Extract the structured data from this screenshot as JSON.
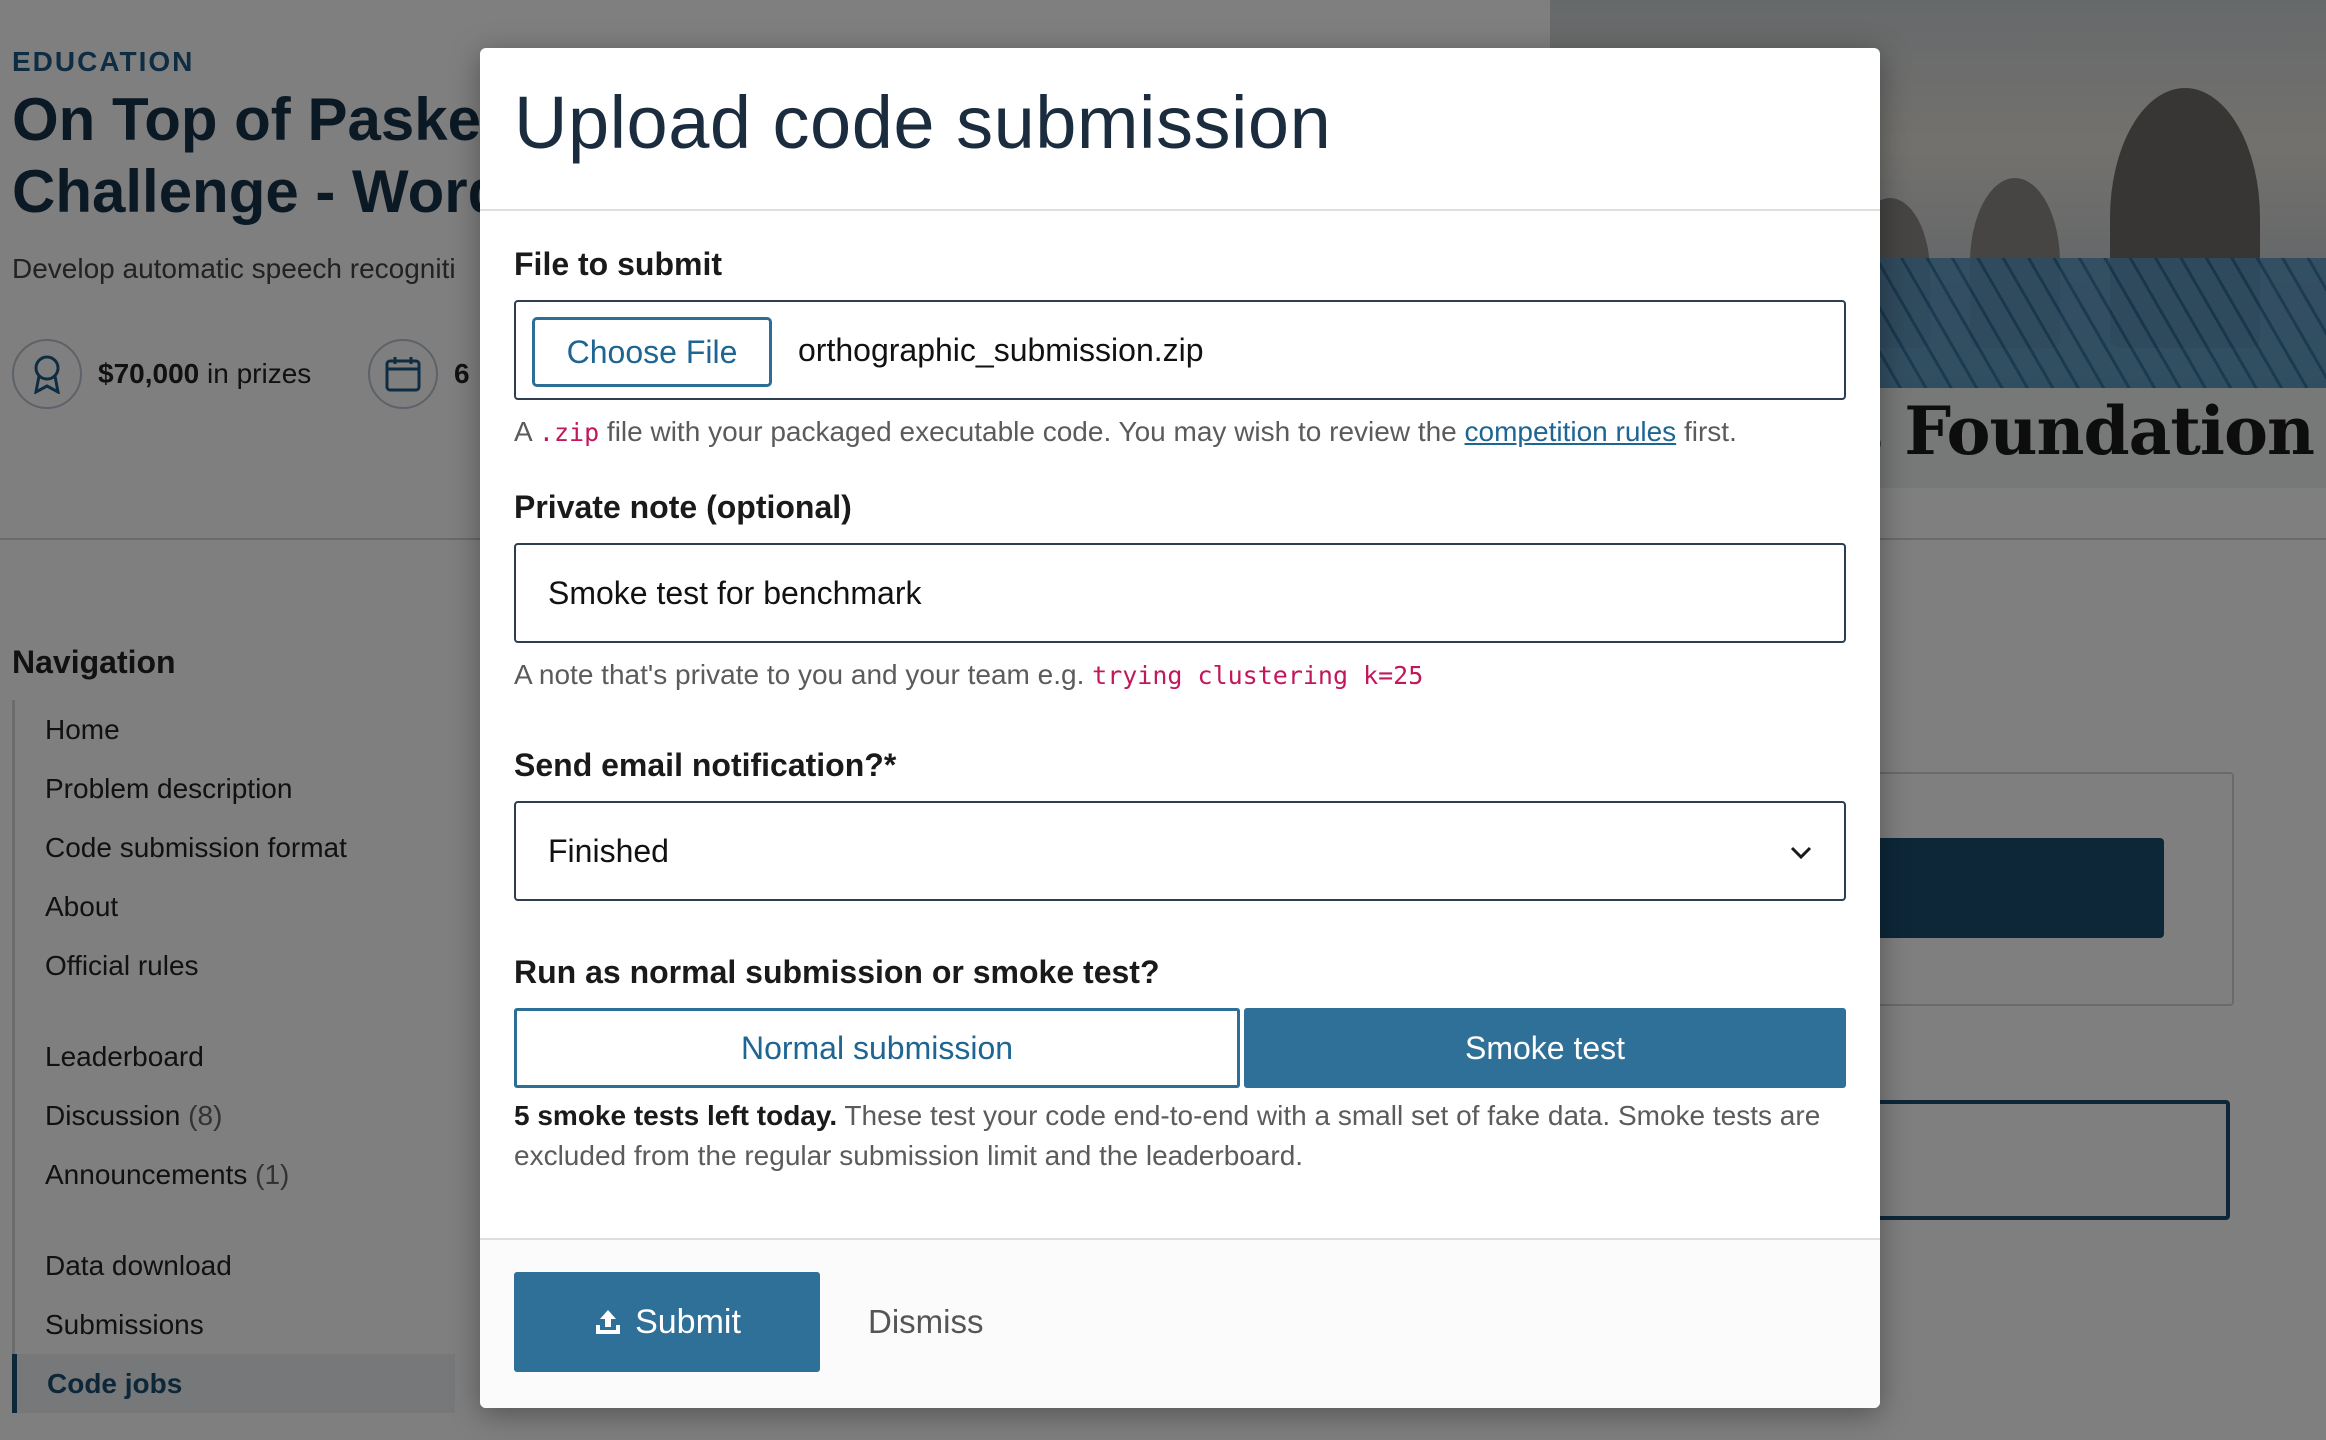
{
  "background": {
    "category": "EDUCATION",
    "title_line1": "On Top of Pasketti",
    "title_line2": "Challenge - Word",
    "subtitle": "Develop automatic speech recogniti",
    "prize_amount": "$70,000",
    "prize_suffix": " in prizes",
    "calendar_stat": "6",
    "foundation_text": "ates Foundation",
    "nav": {
      "title": "Navigation",
      "group1": [
        "Home",
        "Problem description",
        "Code submission format",
        "About",
        "Official rules"
      ],
      "leaderboard": "Leaderboard",
      "discussion": "Discussion",
      "discussion_count": "(8)",
      "announcements": "Announcements",
      "announcements_count": "(1)",
      "data_download": "Data download",
      "submissions": "Submissions",
      "code_jobs": "Code jobs"
    }
  },
  "modal": {
    "title": "Upload code submission",
    "file_label": "File to submit",
    "choose_file": "Choose File",
    "file_name": "orthographic_submission.zip",
    "file_help_prefix": "A ",
    "file_help_code": ".zip",
    "file_help_mid": " file with your packaged executable code. You may wish to review the ",
    "file_help_link": "competition rules",
    "file_help_suffix": " first.",
    "note_label": "Private note (optional)",
    "note_value": "Smoke test for benchmark",
    "note_help_prefix": "A note that's private to you and your team e.g. ",
    "note_help_code": "trying clustering k=25",
    "email_label": "Send email notification?*",
    "email_value": "Finished",
    "run_label": "Run as normal submission or smoke test?",
    "normal_option": "Normal submission",
    "smoke_option": "Smoke test",
    "smoke_count": "5 smoke tests left today.",
    "smoke_desc": " These test your code end-to-end with a small set of fake data. Smoke tests are excluded from the regular submission limit and the leaderboard.",
    "submit": "Submit",
    "dismiss": "Dismiss"
  },
  "colors": {
    "accent": "#2f7099",
    "code": "#c2185b",
    "overlay": "rgba(0,0,0,0.5)"
  }
}
